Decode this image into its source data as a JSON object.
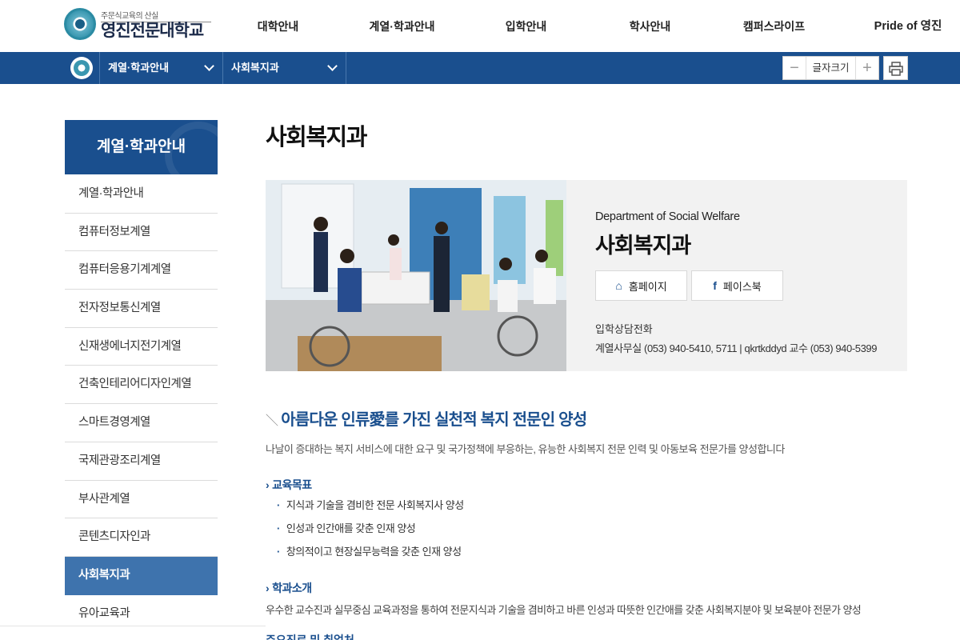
{
  "header": {
    "logo": {
      "slogan": "주문식교육의 산실",
      "name": "영진전문대학교"
    },
    "nav": [
      "대학안내",
      "계열·학과안내",
      "입학안내",
      "학사안내",
      "캠퍼스라이프",
      "Pride of 영진"
    ]
  },
  "subbar": {
    "crumb1": "계열·학과안내",
    "crumb2": "사회복지과",
    "font_size_label": "글자크기",
    "font_minus": "−",
    "font_plus": "+"
  },
  "sidebar": {
    "title": "계열·학과안내",
    "items": [
      "계열·학과안내",
      "컴퓨터정보계열",
      "컴퓨터응용기계계열",
      "전자정보통신계열",
      "신재생에너지전기계열",
      "건축인테리어디자인계열",
      "스마트경영계열",
      "국제관광조리계열",
      "부사관계열",
      "콘텐츠디자인과",
      "사회복지과",
      "유아교육과"
    ],
    "active_index": 10
  },
  "main": {
    "page_title": "사회복지과",
    "dept": {
      "name_en": "Department of Social Welfare",
      "name_ko": "사회복지과",
      "homepage_label": "홈페이지",
      "facebook_label": "페이스북",
      "tel_label": "입학상담전화",
      "tel_detail": "계열사무실 (053) 940-5410, 5711  |  qkrtkddyd 교수 (053) 940-5399"
    },
    "headline": "아름다운 인류愛를 가진 실천적 복지 전문인 양성",
    "intro": "나날이 증대하는 복지 서비스에 대한 요구 및 국가정책에 부응하는, 유능한 사회복지 전문 인력 및 아동보육 전문가를 양성합니다",
    "goals_title": "교육목표",
    "goals": [
      "지식과 기술을 겸비한 전문 사회복지사 양성",
      "인성과 인간애를 갖춘 인재 양성",
      "창의적이고 현장실무능력을 갖춘 인재 양성"
    ],
    "about_title": "학과소개",
    "about_text": "우수한 교수진과 실무중심 교육과정을 통하여 전문지식과 기술을 겸비하고 바른 인성과 따뜻한 인간애를 갖춘 사회복지분야 및 보육분야 전문가 양성",
    "next_section_partial": "주요진로 및 취업처"
  },
  "colors": {
    "primary": "#1a4f8e",
    "active": "#3e73ad",
    "panel": "#f2f2f2"
  }
}
